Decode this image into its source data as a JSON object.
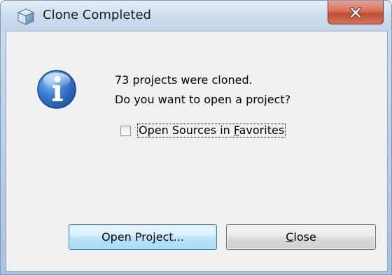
{
  "dialog": {
    "title": "Clone Completed",
    "message_line1": "73 projects were cloned.",
    "message_line2": "Do you want to open a project?",
    "checkbox": {
      "label_pre": "Open Sources in ",
      "label_mnemonic": "F",
      "label_post": "avorites",
      "checked": false
    },
    "buttons": {
      "open_project_label": "Open Project...",
      "close_mnemonic": "C",
      "close_rest": "lose"
    },
    "icons": {
      "title": "cube-icon",
      "message": "info-icon",
      "window_close": "close-icon"
    },
    "colors": {
      "info_blue": "#2b6cc4",
      "close_button_red": "#c9503a",
      "default_button_border": "#3c7fb1"
    }
  }
}
